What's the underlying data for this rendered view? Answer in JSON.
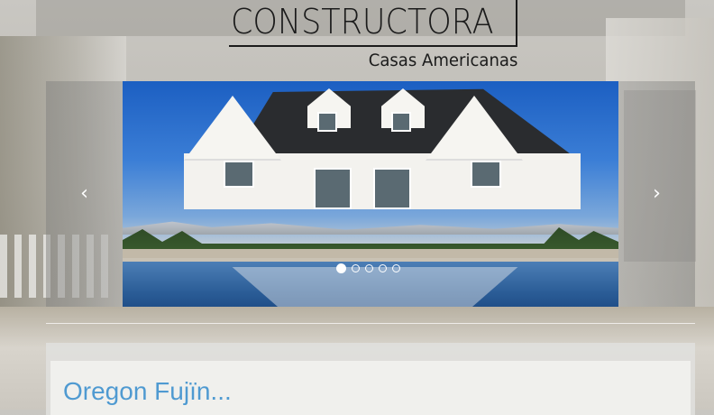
{
  "logo": {
    "title": "CONSTRUCTORA",
    "subtitle": "Casas Americanas"
  },
  "carousel": {
    "prev_label": "‹",
    "next_label": "›",
    "slide_count": 5,
    "active_index": 0
  },
  "section": {
    "heading": "Oregon Fujïn..."
  },
  "colors": {
    "heading_accent": "#4f9ad1",
    "logo_ink": "#1b1b1b"
  }
}
